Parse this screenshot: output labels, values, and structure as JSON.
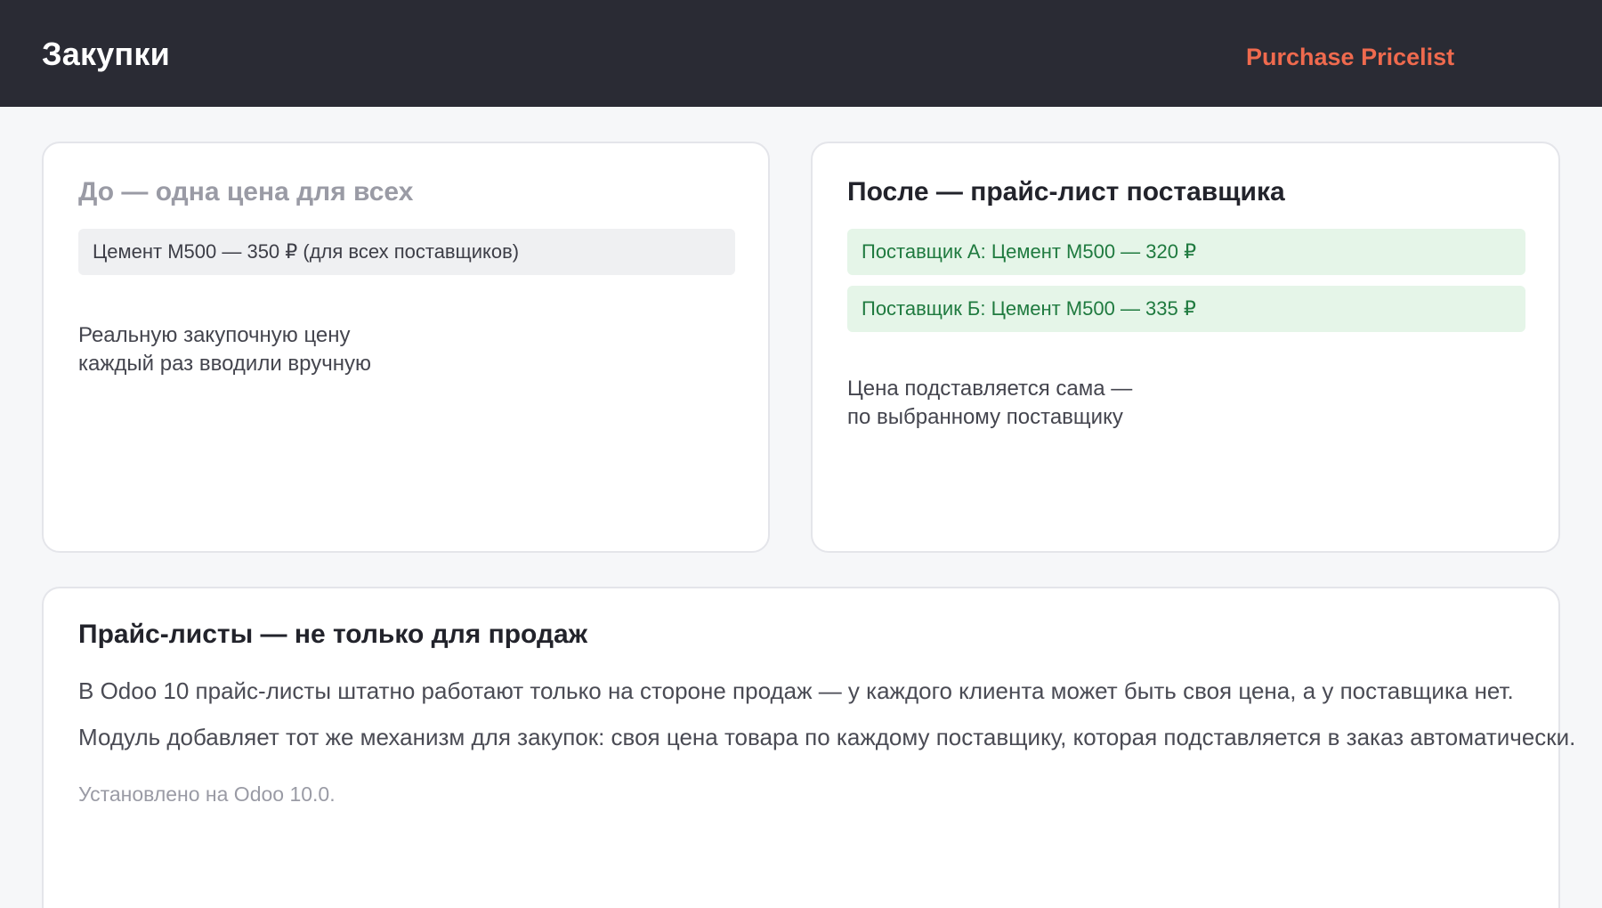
{
  "header": {
    "title": "Закупки",
    "module_name": "Purchase Pricelist"
  },
  "before": {
    "heading": "До — одна цена для всех",
    "price_line": "Цемент М500 — 350 ₽ (для всех поставщиков)",
    "note_lines": [
      "Реальную закупочную цену",
      "каждый раз вводили вручную"
    ]
  },
  "after": {
    "heading": "После — прайс-лист поставщика",
    "price_lines": [
      "Поставщик А: Цемент М500 — 320 ₽",
      "Поставщик Б: Цемент М500 — 335 ₽"
    ],
    "note_lines": [
      "Цена подставляется сама —",
      "по выбранному поставщику"
    ]
  },
  "info": {
    "heading": "Прайс-листы — не только для продаж",
    "paragraphs": [
      "В Odoo 10 прайс-листы штатно работают только на стороне продаж — у каждого клиента может быть своя цена, а у поставщика нет.",
      "Модуль добавляет тот же механизм для закупок: своя цена товара по каждому поставщику, которая подставляется в заказ автоматически."
    ],
    "installed": "Установлено на Odoo 10.0."
  },
  "colors": {
    "header_bg": "#2a2b34",
    "accent": "#ef6a4e",
    "positive_bg": "#e5f5e8",
    "positive_text": "#1f7a3f"
  }
}
